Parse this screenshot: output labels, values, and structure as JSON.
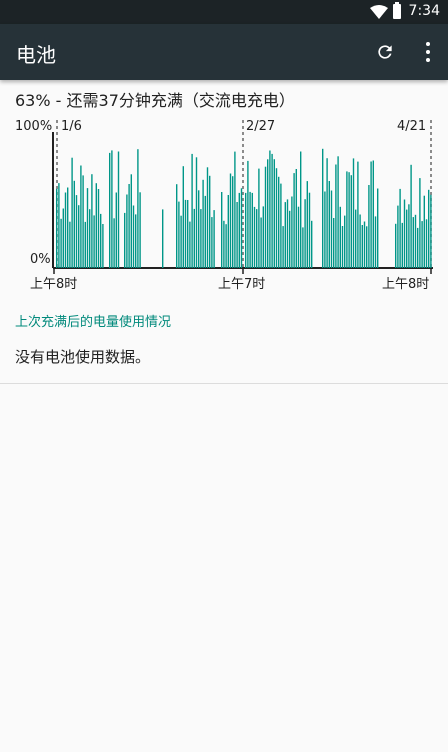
{
  "status_bar": {
    "time": "7:34",
    "icons": [
      "wifi-icon",
      "battery-icon"
    ]
  },
  "app_bar": {
    "title": "电池",
    "actions": [
      "refresh-icon",
      "more-vert-icon"
    ]
  },
  "summary": "63% - 还需37分钟充满（交流电充电）",
  "chart": {
    "y_labels": [
      "100%",
      "0%"
    ],
    "date_markers": [
      "1/6",
      "2/27",
      "4/21"
    ],
    "time_labels": [
      "上午8时",
      "上午7时",
      "上午8时"
    ],
    "bar_color": "#009688"
  },
  "section_header": "上次充满后的电量使用情况",
  "empty_message": "没有电池使用数据。"
}
